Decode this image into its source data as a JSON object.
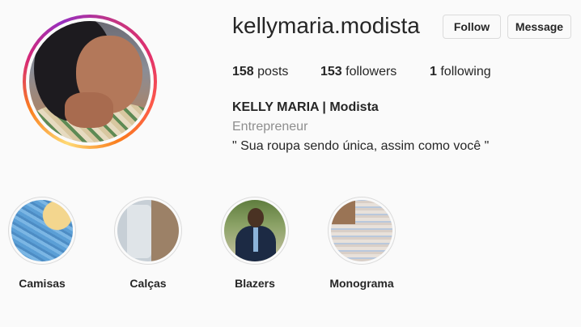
{
  "profile": {
    "username": "kellymaria.modista",
    "follow_label": "Follow",
    "message_label": "Message",
    "stats": {
      "posts_count": "158",
      "posts_label": "posts",
      "followers_count": "153",
      "followers_label": "followers",
      "following_count": "1",
      "following_label": "following"
    },
    "full_name": "KELLY MARIA | Modista",
    "category": "Entrepreneur",
    "bio": "\" Sua roupa sendo única, assim como você \""
  },
  "highlights": [
    {
      "label": "Camisas"
    },
    {
      "label": "Calças"
    },
    {
      "label": "Blazers"
    },
    {
      "label": "Monograma"
    }
  ],
  "colors": {
    "background": "#fafafa",
    "text": "#262626",
    "muted_text": "#8e8e8e",
    "border": "#dbdbdb"
  }
}
